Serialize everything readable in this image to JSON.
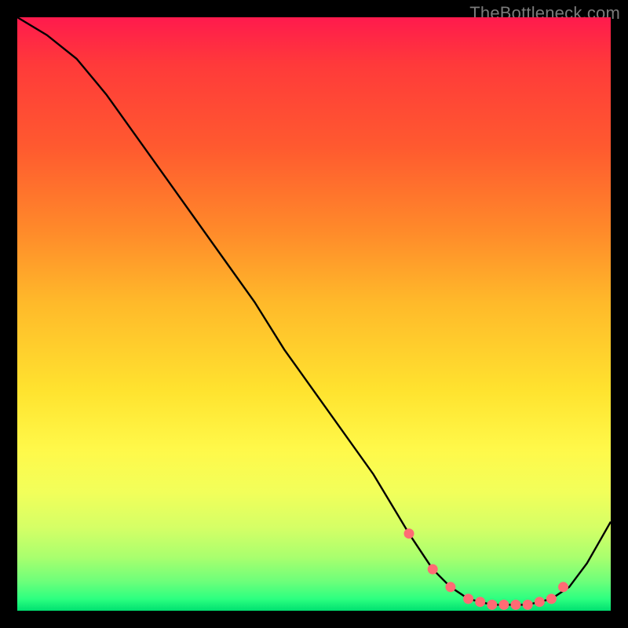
{
  "attribution": "TheBottleneck.com",
  "colors": {
    "frame": "#000000",
    "marker": "#ff6b74",
    "curve": "#000000"
  },
  "chart_data": {
    "type": "line",
    "title": "",
    "xlabel": "",
    "ylabel": "",
    "xlim": [
      0,
      100
    ],
    "ylim": [
      0,
      100
    ],
    "grid": false,
    "legend": false,
    "series": [
      {
        "name": "bottleneck-curve",
        "x": [
          0,
          5,
          10,
          15,
          20,
          25,
          30,
          35,
          40,
          45,
          50,
          55,
          60,
          63,
          66,
          70,
          73,
          76,
          80,
          83,
          86,
          90,
          93,
          96,
          100
        ],
        "y": [
          100,
          97,
          93,
          87,
          80,
          73,
          66,
          59,
          52,
          44,
          37,
          30,
          23,
          18,
          13,
          7,
          4,
          2,
          1,
          1,
          1,
          2,
          4,
          8,
          15
        ]
      }
    ],
    "markers": {
      "name": "highlight-points",
      "x": [
        66,
        70,
        73,
        76,
        78,
        80,
        82,
        84,
        86,
        88,
        90,
        92
      ],
      "y": [
        13,
        7,
        4,
        2,
        1.5,
        1,
        1,
        1,
        1,
        1.5,
        2,
        4
      ]
    }
  }
}
